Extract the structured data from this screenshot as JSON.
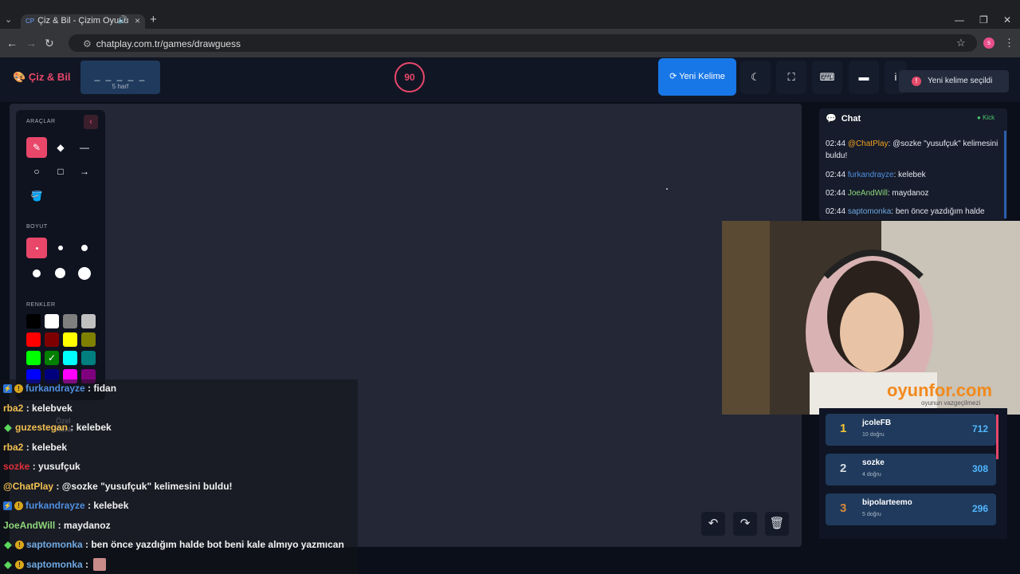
{
  "browser": {
    "tab_title": "Çiz & Bil - Çizim Oyunu",
    "tab_favicon": "CP",
    "url": "chatplay.com.tr/games/drawguess",
    "profile_initial": "s"
  },
  "app": {
    "logo": "Çiz & Bil",
    "word_blanks": "_ _ _ _ _",
    "word_hint": "5 harf",
    "timer": "90",
    "new_word_label": "Yeni Kelime",
    "toast": "Yeni kelime seçildi"
  },
  "tools": {
    "label_tools": "ARAÇLAR",
    "label_size": "BOYUT",
    "label_colors": "RENKLER",
    "custom_color": "Özel Renk",
    "colors": [
      "#000000",
      "#ffffff",
      "#7f7f7f",
      "#c0c0c0",
      "#ff0000",
      "#7f0000",
      "#ffff00",
      "#7f7f00",
      "#00ff00",
      "#007f00",
      "#00ffff",
      "#007f7f",
      "#0000ff",
      "#00007f",
      "#ff00ff",
      "#7f007f"
    ],
    "selected_color": "#007f00"
  },
  "chat": {
    "title": "Chat",
    "status": "Kick",
    "messages": [
      {
        "time": "02:44",
        "user": "@ChatPlay",
        "user_color": "#f0a020",
        "text": ": @sozke \"yusufçuk\" kelimesini buldu!"
      },
      {
        "time": "02:44",
        "user": "furkandrayze",
        "user_color": "#4f8fe0",
        "text": ": kelebek"
      },
      {
        "time": "02:44",
        "user": "JoeAndWill",
        "user_color": "#8ed67a",
        "text": ": maydanoz"
      },
      {
        "time": "02:44",
        "user": "saptomonka",
        "user_color": "#6fa8e0",
        "text": ": ben önce yazdığım halde"
      }
    ]
  },
  "webcam": {
    "watermark": "oyunfor.com",
    "tagline": "oyunun vazgeçilmezi"
  },
  "leaderboard": [
    {
      "rank": "1",
      "name": "jcoleFB",
      "sub": "10 doğru",
      "points": "712",
      "rank_color": "#f2c531"
    },
    {
      "rank": "2",
      "name": "sozke",
      "sub": "4 doğru",
      "points": "308",
      "rank_color": "#d7dbe3"
    },
    {
      "rank": "3",
      "name": "bipolarteemo",
      "sub": "5 doğru",
      "points": "296",
      "rank_color": "#d98a3a"
    }
  ],
  "stream_chat": [
    {
      "badges": [
        "blue",
        "gold"
      ],
      "user": "furkandrayze",
      "user_color": "#4f8fe0",
      "text": ": fidan"
    },
    {
      "badges": [],
      "user": "rba2",
      "user_color": "#f0c050",
      "text": ": kelebvek"
    },
    {
      "badges": [
        "green"
      ],
      "user": "guzestegan",
      "user_color": "#f0c050",
      "text": ": kelebek"
    },
    {
      "badges": [],
      "user": "rba2",
      "user_color": "#f0c050",
      "text": ": kelebek"
    },
    {
      "badges": [],
      "user": "sozke",
      "user_color": "#e0303a",
      "text": ": yusufçuk"
    },
    {
      "badges": [],
      "user": "@ChatPlay",
      "user_color": "#f0c050",
      "text": ": @sozke \"yusufçuk\" kelimesini buldu!"
    },
    {
      "badges": [
        "blue",
        "gold"
      ],
      "user": "furkandrayze",
      "user_color": "#4f8fe0",
      "text": ": kelebek"
    },
    {
      "badges": [],
      "user": "JoeAndWill",
      "user_color": "#8ed67a",
      "text": ": maydanoz"
    },
    {
      "badges": [
        "green",
        "gold"
      ],
      "user": "saptomonka",
      "user_color": "#6fa8e0",
      "text": ": ben önce yazdığım halde bot beni kale almıyo yazmıcan"
    },
    {
      "badges": [
        "green",
        "gold"
      ],
      "user": "saptomonka",
      "user_color": "#6fa8e0",
      "text": ":"
    }
  ]
}
